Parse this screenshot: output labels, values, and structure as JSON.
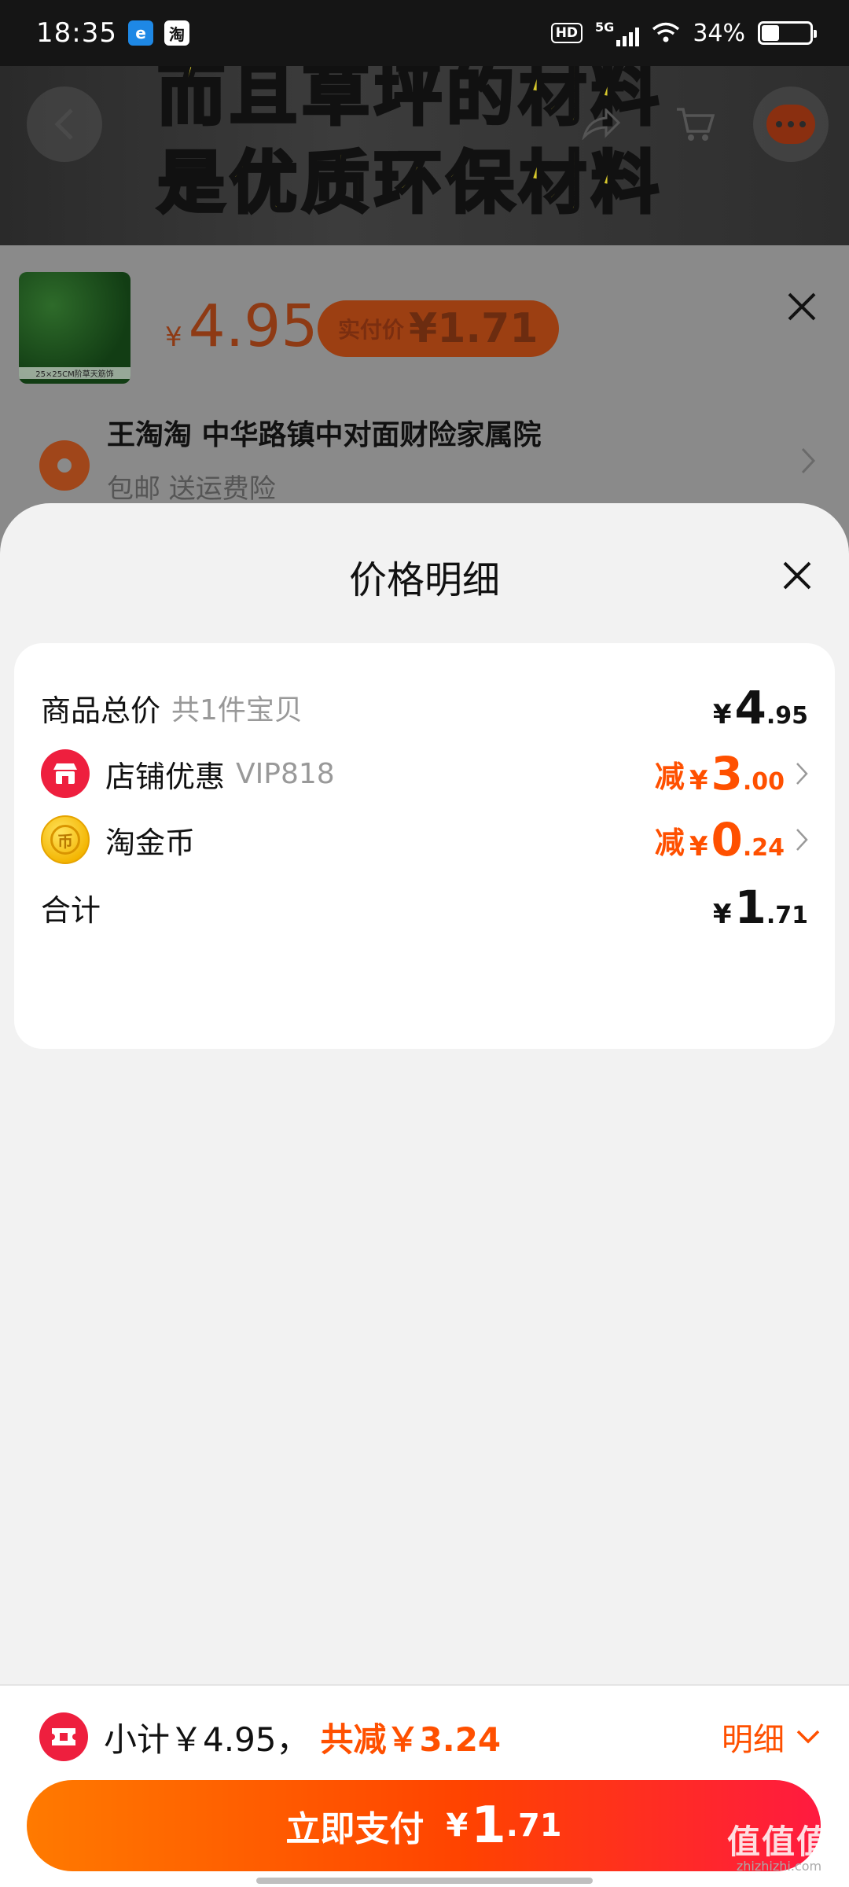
{
  "status_bar": {
    "time": "18:35",
    "app_icons": [
      "browser-icon",
      "taobao-icon"
    ],
    "taobao_icon_text": "淘",
    "hd": "HD",
    "network": "5G",
    "battery_text": "34%",
    "battery_level": 0.34
  },
  "background": {
    "caption_line1": "而且草坪的材料",
    "caption_line2": "是优质环保材料",
    "thumb_label": "25×25CM阶草天筋饰",
    "price_yen": "¥",
    "price": "4.95",
    "paid_label": "实付价",
    "paid_value": "¥1.71",
    "address": "王淘淘 中华路镇中对面财险家属院",
    "shipping": "包邮  送运费险"
  },
  "sheet": {
    "title": "价格明细",
    "rows": [
      {
        "label": "商品总价",
        "sub": "共1件宝贝",
        "yen": "¥",
        "int": "4",
        "dec": ".95"
      },
      {
        "label": "店铺优惠",
        "sub": "VIP818",
        "prefix": "减",
        "yen": "¥",
        "int": "3",
        "dec": ".00"
      },
      {
        "label": "淘金币",
        "prefix": "减",
        "yen": "¥",
        "int": "0",
        "dec": ".24"
      },
      {
        "label": "合计",
        "yen": "¥",
        "int": "1",
        "dec": ".71"
      }
    ]
  },
  "footer": {
    "subtotal": "小计￥4.95，",
    "total_discount": "共减￥3.24",
    "detail_label": "明细",
    "pay_label": "立即支付",
    "pay_yen": "¥",
    "pay_int": "1",
    "pay_dec": ".71"
  },
  "watermark": {
    "main": "值值值",
    "sub": "zhizhizhi.com"
  },
  "colors": {
    "accent": "#ff5000",
    "shop_red": "#ee1f3e",
    "coin_gold": "#f3b400"
  }
}
